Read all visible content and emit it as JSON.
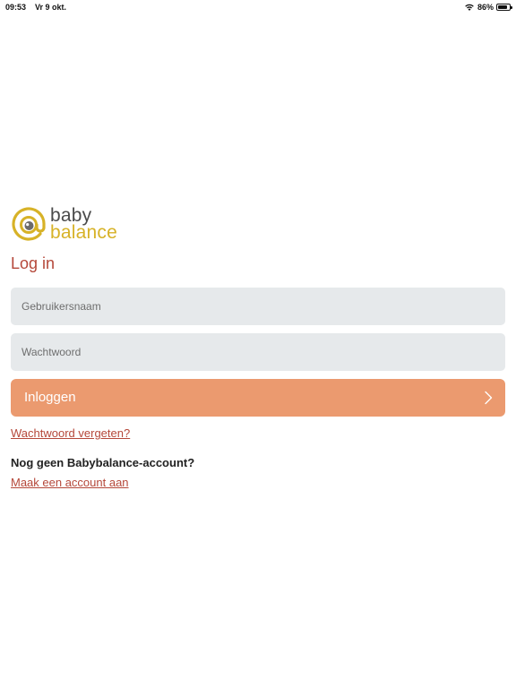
{
  "status_bar": {
    "time": "09:53",
    "date": "Vr 9 okt.",
    "battery_percent": "86%",
    "battery_level": 0.86,
    "wifi_icon": "wifi-icon",
    "battery_icon": "battery-icon"
  },
  "logo": {
    "word_1": "baby",
    "word_2": "balance",
    "mark_icon": "at-sign-baby-icon",
    "colors": {
      "gold": "#d7b227",
      "grey": "#4a4a4a"
    }
  },
  "login": {
    "title": "Log in",
    "username_placeholder": "Gebruikersnaam",
    "username_value": "",
    "password_placeholder": "Wachtwoord",
    "password_value": "",
    "button_label": "Inloggen",
    "button_icon": "chevron-right-icon",
    "forgot_password": "Wachtwoord vergeten?",
    "no_account": "Nog geen Babybalance-account?",
    "create_account": "Maak een account aan"
  },
  "colors": {
    "accent": "#b5483a",
    "button": "#eb9a6f",
    "field_bg": "#e6e9eb"
  }
}
